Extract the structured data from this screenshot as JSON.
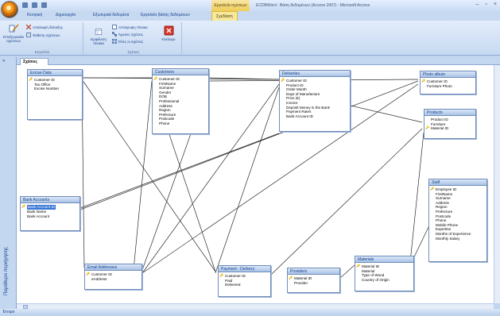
{
  "title_bar": {
    "context_label": "Εργαλεία σχέσεων",
    "window_title": "ECDBWord : Βάση δεδομένων (Access 2007) - Microsoft Access",
    "controls": [
      "–",
      "▫",
      "×"
    ]
  },
  "tabs": [
    "Κεντρική",
    "Δημιουργία",
    "Εξωτερικά δεδομένα",
    "Εργαλεία βάσης δεδομένων",
    "Σχεδίαση"
  ],
  "ribbon": {
    "tools_group": {
      "edit_relationships": "Επεξεργασία σχέσεων",
      "clear_layout": "Απαλοιφή διάταξης",
      "relationship_report": "Έκθεση σχέσεων",
      "label": "Εργαλεία"
    },
    "relationships_group": {
      "show_table": "Εμφάνιση πίνακα",
      "hide_table": "Απόκρυψη πίνακα",
      "direct_relationships": "Άμεσες σχέσεις",
      "all_relationships": "Όλες οι σχέσεις",
      "close": "Κλείσιμο",
      "label": "Σχέσεις"
    }
  },
  "nav_pane": {
    "label": "Παράθυρο περιήγησης",
    "toggle": "»"
  },
  "document_tab": "Σχέσεις",
  "status_bar": "Έτοιμο",
  "tables": [
    {
      "title": "Excise Data",
      "fields": [
        {
          "name": "Customer ID",
          "key": true
        },
        {
          "name": "Tax Office"
        },
        {
          "name": "Excise Number"
        }
      ]
    },
    {
      "title": "Customers",
      "fields": [
        {
          "name": "Customer ID",
          "key": true
        },
        {
          "name": "FirstName"
        },
        {
          "name": "Surname"
        },
        {
          "name": "Gender"
        },
        {
          "name": "DOB"
        },
        {
          "name": "Professional"
        },
        {
          "name": "Address"
        },
        {
          "name": "Region"
        },
        {
          "name": "Prefecture"
        },
        {
          "name": "Postcode"
        },
        {
          "name": "Phone"
        }
      ]
    },
    {
      "title": "Deliveries",
      "fields": [
        {
          "name": "Customer ID",
          "key": true
        },
        {
          "name": "Product ID"
        },
        {
          "name": "Order Month"
        },
        {
          "name": "Days of Manufacture"
        },
        {
          "name": "Price (€)"
        },
        {
          "name": "Invoice"
        },
        {
          "name": "Deposit Money in the Bank"
        },
        {
          "name": "Payment Rates"
        },
        {
          "name": "Bank Account ID"
        }
      ]
    },
    {
      "title": "Photo album",
      "fields": [
        {
          "name": "Customer ID",
          "key": true
        },
        {
          "name": "Furniture Photo"
        }
      ]
    },
    {
      "title": "Products",
      "fields": [
        {
          "name": "Product ID"
        },
        {
          "name": "Furniture"
        },
        {
          "name": "Material ID",
          "key": true
        }
      ]
    },
    {
      "title": "Staff",
      "fields": [
        {
          "name": "Employee ID",
          "key": true
        },
        {
          "name": "FirstName"
        },
        {
          "name": "Surname"
        },
        {
          "name": "Address"
        },
        {
          "name": "Region"
        },
        {
          "name": "Prefecture"
        },
        {
          "name": "Postcode"
        },
        {
          "name": "Phone"
        },
        {
          "name": "Mobile Phone"
        },
        {
          "name": "Expertise"
        },
        {
          "name": "Months of Experience"
        },
        {
          "name": "Monthly Salary"
        }
      ]
    },
    {
      "title": "Bank Accounts",
      "fields": [
        {
          "name": "Bank Account ID",
          "key": true,
          "selected": true
        },
        {
          "name": "Bank Name"
        },
        {
          "name": "Bank Account"
        }
      ]
    },
    {
      "title": "Email Addresses",
      "fields": [
        {
          "name": "Customer ID",
          "key": true
        },
        {
          "name": "eAddress"
        }
      ]
    },
    {
      "title": "Payment - Delivery",
      "fields": [
        {
          "name": "Customer ID",
          "key": true
        },
        {
          "name": "Paid"
        },
        {
          "name": "Delivered"
        }
      ]
    },
    {
      "title": "Providers",
      "fields": [
        {
          "name": "Material ID",
          "key": true
        },
        {
          "name": "Provider"
        }
      ]
    },
    {
      "title": "Materials",
      "fields": [
        {
          "name": "Material ID",
          "key": true
        },
        {
          "name": "Material"
        },
        {
          "name": "Type of Wood"
        },
        {
          "name": "Country of Origin"
        }
      ]
    }
  ],
  "colors": {
    "accent": "#15428b",
    "ribbon": "#c6d9f1",
    "selection": "#3875d7"
  }
}
